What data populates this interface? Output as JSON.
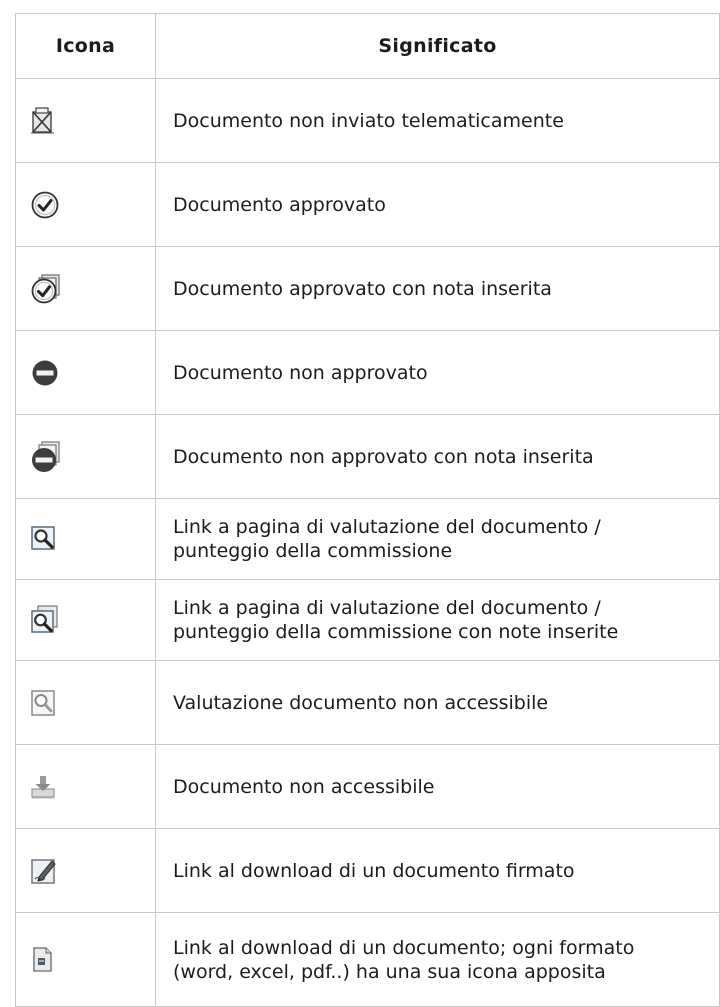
{
  "table": {
    "headers": {
      "icon": "Icona",
      "meaning": "Significato"
    },
    "rows": [
      {
        "icon": "document-not-sent-icon",
        "text": "Documento non inviato telematicamente"
      },
      {
        "icon": "check-circle-icon",
        "text": "Documento approvato"
      },
      {
        "icon": "check-circle-note-icon",
        "text": "Documento approvato con nota inserita"
      },
      {
        "icon": "no-entry-icon",
        "text": "Documento non approvato"
      },
      {
        "icon": "no-entry-note-icon",
        "text": "Documento non approvato con nota inserita"
      },
      {
        "icon": "magnifier-icon",
        "text": "Link a pagina di valutazione del documento /\npunteggio della commissione"
      },
      {
        "icon": "magnifier-note-icon",
        "text": "Link a pagina di valutazione del documento /\npunteggio della commissione con note inserite"
      },
      {
        "icon": "magnifier-disabled-icon",
        "text": "Valutazione documento non accessibile"
      },
      {
        "icon": "download-disabled-icon",
        "text": "Documento non accessibile"
      },
      {
        "icon": "signed-document-icon",
        "text": "Link al download di un documento firmato"
      },
      {
        "icon": "document-file-icon",
        "text": "Link al download di un documento; ogni formato\n(word, excel, pdf..) ha una sua icona apposita"
      }
    ]
  }
}
